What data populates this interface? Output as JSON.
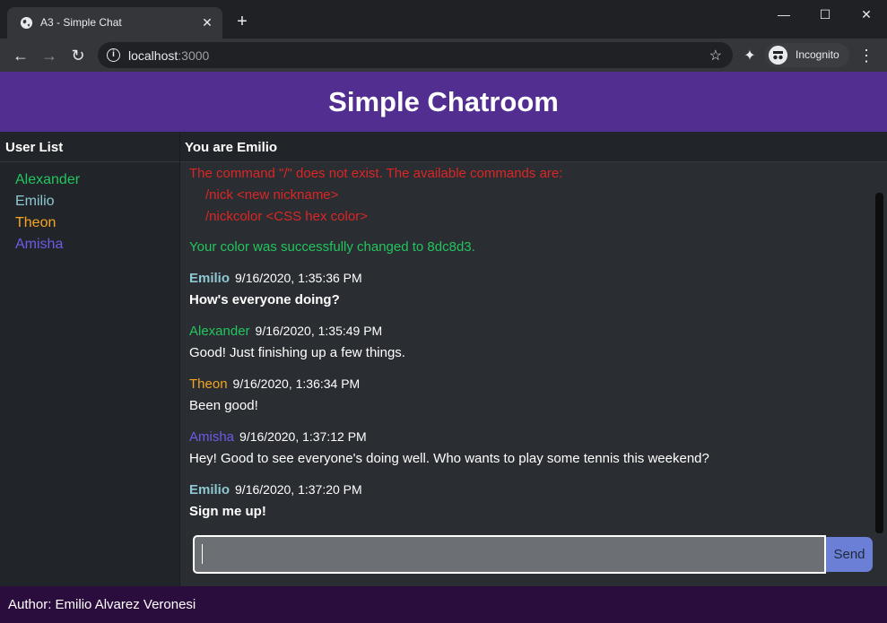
{
  "browser": {
    "tab_title": "A3 - Simple Chat",
    "url_host": "localhost",
    "url_port": ":3000",
    "incognito_label": "Incognito"
  },
  "app": {
    "title": "Simple Chatroom",
    "user_list_heading": "User List",
    "current_user_heading": "You are Emilio",
    "users": [
      {
        "name": "Alexander",
        "color": "#22c55e"
      },
      {
        "name": "Emilio",
        "color": "#8dc8d3"
      },
      {
        "name": "Theon",
        "color": "#f5a623"
      },
      {
        "name": "Amisha",
        "color": "#6b5ce7"
      }
    ],
    "system_messages": {
      "error_line1": "The command \"/\" does not exist. The available commands are:",
      "error_line2": "/nick <new nickname>",
      "error_line3": "/nickcolor <CSS hex color>",
      "success": "Your color was successfully changed to 8dc8d3."
    },
    "messages": [
      {
        "author": "Emilio",
        "color": "#8dc8d3",
        "timestamp": "9/16/2020, 1:35:36 PM",
        "text": "How's everyone doing?",
        "bold": true
      },
      {
        "author": "Alexander",
        "color": "#22c55e",
        "timestamp": "9/16/2020, 1:35:49 PM",
        "text": "Good! Just finishing up a few things.",
        "bold": false
      },
      {
        "author": "Theon",
        "color": "#f5a623",
        "timestamp": "9/16/2020, 1:36:34 PM",
        "text": "Been good!",
        "bold": false
      },
      {
        "author": "Amisha",
        "color": "#6b5ce7",
        "timestamp": "9/16/2020, 1:37:12 PM",
        "text": "Hey! Good to see everyone's doing well. Who wants to play some tennis this weekend?",
        "bold": false
      },
      {
        "author": "Emilio",
        "color": "#8dc8d3",
        "timestamp": "9/16/2020, 1:37:20 PM",
        "text": "Sign me up!",
        "bold": true
      }
    ],
    "input_value": "",
    "send_label": "Send",
    "footer": "Author: Emilio Alvarez Veronesi"
  }
}
